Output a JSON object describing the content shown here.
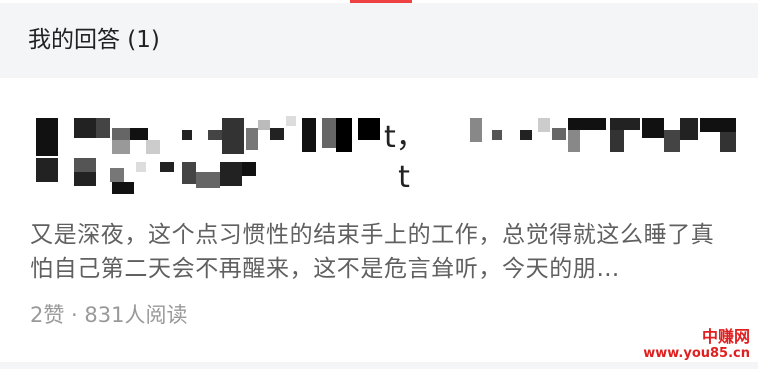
{
  "header": {
    "title": "我的回答 (1)"
  },
  "answer": {
    "title_visible_fragment": "t，t",
    "excerpt": "又是深夜，这个点习惯性的结束手上的工作，总觉得就这么睡了真怕自己第二天会不再醒来，这不是危言耸听，今天的朋…",
    "meta": "2赞 · 831人阅读"
  },
  "watermark": {
    "name": "中赚网",
    "url": "www.you85.cn"
  },
  "colors": {
    "accent": "#f04142",
    "header_bg": "#f4f5f6",
    "body_text": "#606060",
    "meta_text": "#999999",
    "watermark": "#e02020"
  }
}
